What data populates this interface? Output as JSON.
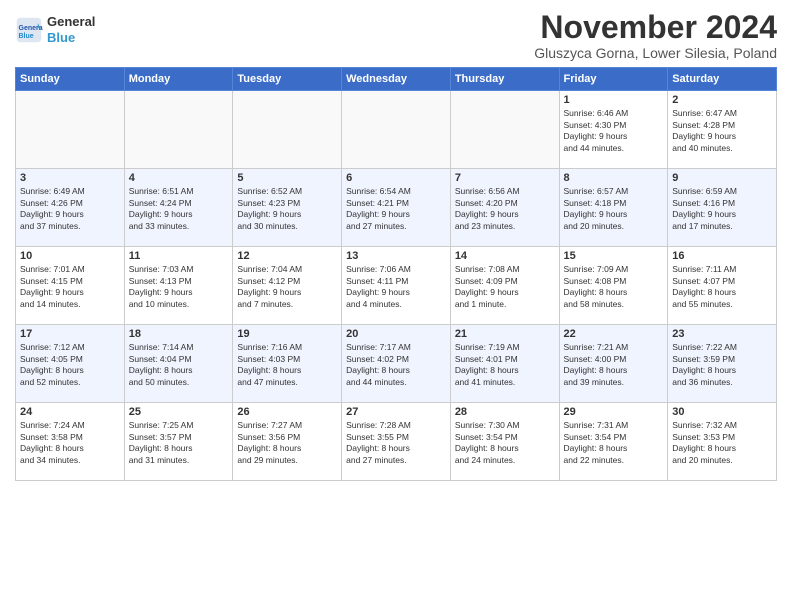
{
  "header": {
    "logo_line1": "General",
    "logo_line2": "Blue",
    "month_title": "November 2024",
    "subtitle": "Gluszyca Gorna, Lower Silesia, Poland"
  },
  "days_of_week": [
    "Sunday",
    "Monday",
    "Tuesday",
    "Wednesday",
    "Thursday",
    "Friday",
    "Saturday"
  ],
  "weeks": [
    [
      {
        "day": "",
        "info": ""
      },
      {
        "day": "",
        "info": ""
      },
      {
        "day": "",
        "info": ""
      },
      {
        "day": "",
        "info": ""
      },
      {
        "day": "",
        "info": ""
      },
      {
        "day": "1",
        "info": "Sunrise: 6:46 AM\nSunset: 4:30 PM\nDaylight: 9 hours\nand 44 minutes."
      },
      {
        "day": "2",
        "info": "Sunrise: 6:47 AM\nSunset: 4:28 PM\nDaylight: 9 hours\nand 40 minutes."
      }
    ],
    [
      {
        "day": "3",
        "info": "Sunrise: 6:49 AM\nSunset: 4:26 PM\nDaylight: 9 hours\nand 37 minutes."
      },
      {
        "day": "4",
        "info": "Sunrise: 6:51 AM\nSunset: 4:24 PM\nDaylight: 9 hours\nand 33 minutes."
      },
      {
        "day": "5",
        "info": "Sunrise: 6:52 AM\nSunset: 4:23 PM\nDaylight: 9 hours\nand 30 minutes."
      },
      {
        "day": "6",
        "info": "Sunrise: 6:54 AM\nSunset: 4:21 PM\nDaylight: 9 hours\nand 27 minutes."
      },
      {
        "day": "7",
        "info": "Sunrise: 6:56 AM\nSunset: 4:20 PM\nDaylight: 9 hours\nand 23 minutes."
      },
      {
        "day": "8",
        "info": "Sunrise: 6:57 AM\nSunset: 4:18 PM\nDaylight: 9 hours\nand 20 minutes."
      },
      {
        "day": "9",
        "info": "Sunrise: 6:59 AM\nSunset: 4:16 PM\nDaylight: 9 hours\nand 17 minutes."
      }
    ],
    [
      {
        "day": "10",
        "info": "Sunrise: 7:01 AM\nSunset: 4:15 PM\nDaylight: 9 hours\nand 14 minutes."
      },
      {
        "day": "11",
        "info": "Sunrise: 7:03 AM\nSunset: 4:13 PM\nDaylight: 9 hours\nand 10 minutes."
      },
      {
        "day": "12",
        "info": "Sunrise: 7:04 AM\nSunset: 4:12 PM\nDaylight: 9 hours\nand 7 minutes."
      },
      {
        "day": "13",
        "info": "Sunrise: 7:06 AM\nSunset: 4:11 PM\nDaylight: 9 hours\nand 4 minutes."
      },
      {
        "day": "14",
        "info": "Sunrise: 7:08 AM\nSunset: 4:09 PM\nDaylight: 9 hours\nand 1 minute."
      },
      {
        "day": "15",
        "info": "Sunrise: 7:09 AM\nSunset: 4:08 PM\nDaylight: 8 hours\nand 58 minutes."
      },
      {
        "day": "16",
        "info": "Sunrise: 7:11 AM\nSunset: 4:07 PM\nDaylight: 8 hours\nand 55 minutes."
      }
    ],
    [
      {
        "day": "17",
        "info": "Sunrise: 7:12 AM\nSunset: 4:05 PM\nDaylight: 8 hours\nand 52 minutes."
      },
      {
        "day": "18",
        "info": "Sunrise: 7:14 AM\nSunset: 4:04 PM\nDaylight: 8 hours\nand 50 minutes."
      },
      {
        "day": "19",
        "info": "Sunrise: 7:16 AM\nSunset: 4:03 PM\nDaylight: 8 hours\nand 47 minutes."
      },
      {
        "day": "20",
        "info": "Sunrise: 7:17 AM\nSunset: 4:02 PM\nDaylight: 8 hours\nand 44 minutes."
      },
      {
        "day": "21",
        "info": "Sunrise: 7:19 AM\nSunset: 4:01 PM\nDaylight: 8 hours\nand 41 minutes."
      },
      {
        "day": "22",
        "info": "Sunrise: 7:21 AM\nSunset: 4:00 PM\nDaylight: 8 hours\nand 39 minutes."
      },
      {
        "day": "23",
        "info": "Sunrise: 7:22 AM\nSunset: 3:59 PM\nDaylight: 8 hours\nand 36 minutes."
      }
    ],
    [
      {
        "day": "24",
        "info": "Sunrise: 7:24 AM\nSunset: 3:58 PM\nDaylight: 8 hours\nand 34 minutes."
      },
      {
        "day": "25",
        "info": "Sunrise: 7:25 AM\nSunset: 3:57 PM\nDaylight: 8 hours\nand 31 minutes."
      },
      {
        "day": "26",
        "info": "Sunrise: 7:27 AM\nSunset: 3:56 PM\nDaylight: 8 hours\nand 29 minutes."
      },
      {
        "day": "27",
        "info": "Sunrise: 7:28 AM\nSunset: 3:55 PM\nDaylight: 8 hours\nand 27 minutes."
      },
      {
        "day": "28",
        "info": "Sunrise: 7:30 AM\nSunset: 3:54 PM\nDaylight: 8 hours\nand 24 minutes."
      },
      {
        "day": "29",
        "info": "Sunrise: 7:31 AM\nSunset: 3:54 PM\nDaylight: 8 hours\nand 22 minutes."
      },
      {
        "day": "30",
        "info": "Sunrise: 7:32 AM\nSunset: 3:53 PM\nDaylight: 8 hours\nand 20 minutes."
      }
    ]
  ]
}
